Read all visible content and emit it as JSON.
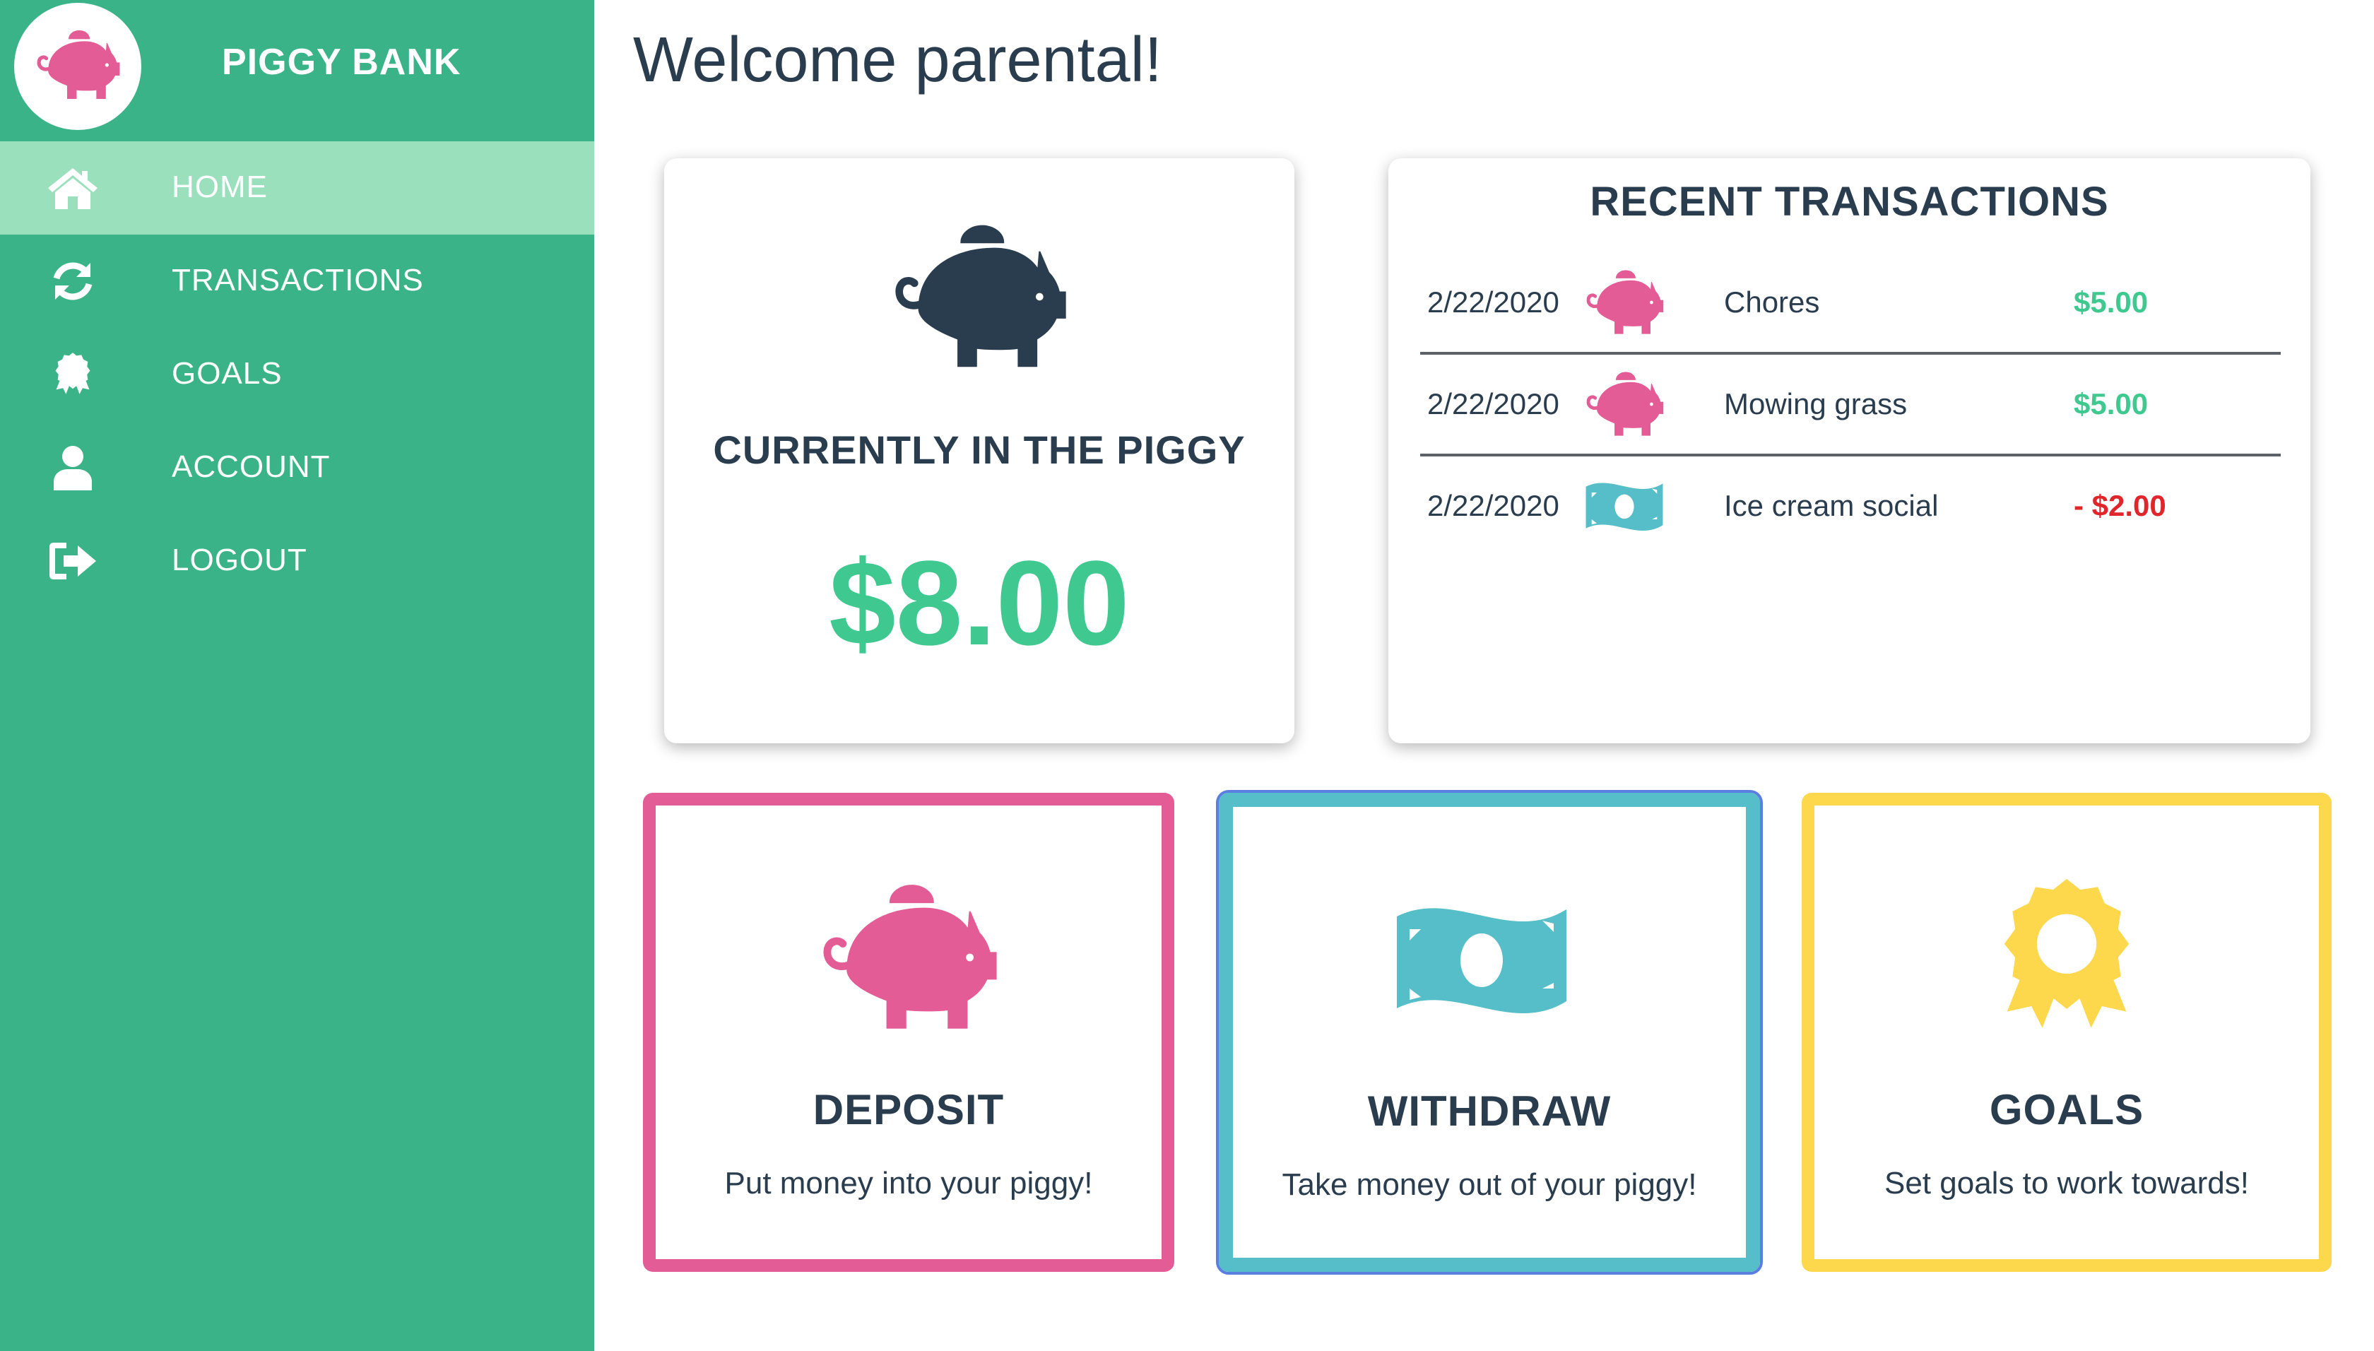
{
  "app": {
    "title": "PIGGY BANK",
    "logo_icon": "piggy-bank-icon",
    "logo_color": "#e35c95"
  },
  "sidebar": {
    "background": "#3bb389",
    "active_background": "#9be0bd",
    "items": [
      {
        "label": "HOME",
        "icon": "home-icon",
        "active": true
      },
      {
        "label": "TRANSACTIONS",
        "icon": "refresh-icon",
        "active": false
      },
      {
        "label": "GOALS",
        "icon": "award-icon",
        "active": false
      },
      {
        "label": "ACCOUNT",
        "icon": "user-icon",
        "active": false
      },
      {
        "label": "LOGOUT",
        "icon": "sign-out-icon",
        "active": false
      }
    ]
  },
  "main": {
    "welcome": "Welcome parental!",
    "balance_card": {
      "label": "CURRENTLY IN THE PIGGY",
      "amount": "$8.00",
      "icon": "piggy-bank-icon"
    },
    "transactions_card": {
      "title": "RECENT TRANSACTIONS",
      "rows": [
        {
          "date": "2/22/2020",
          "icon": "piggy-bank-icon",
          "description": "Chores",
          "amount": "$5.00",
          "type": "deposit"
        },
        {
          "date": "2/22/2020",
          "icon": "piggy-bank-icon",
          "description": "Mowing grass",
          "amount": "$5.00",
          "type": "deposit"
        },
        {
          "date": "2/22/2020",
          "icon": "money-bill-icon",
          "description": "Ice cream social",
          "amount": "- $2.00",
          "type": "withdraw"
        }
      ]
    },
    "actions": [
      {
        "title": "DEPOSIT",
        "subtitle": "Put money into your piggy!",
        "icon": "piggy-bank-icon",
        "color": "#e35c95"
      },
      {
        "title": "WITHDRAW",
        "subtitle": "Take money out of your piggy!",
        "icon": "money-bill-icon",
        "color": "#55bec8"
      },
      {
        "title": "GOALS",
        "subtitle": "Set goals to work towards!",
        "icon": "award-icon",
        "color": "#fdd84c"
      }
    ]
  },
  "colors": {
    "positive": "#3fc88f",
    "negative": "#e0252b",
    "text": "#2a3d4f",
    "pig_pink": "#e35c95",
    "bill_teal": "#55bec8",
    "award_yellow": "#fdd84c"
  }
}
